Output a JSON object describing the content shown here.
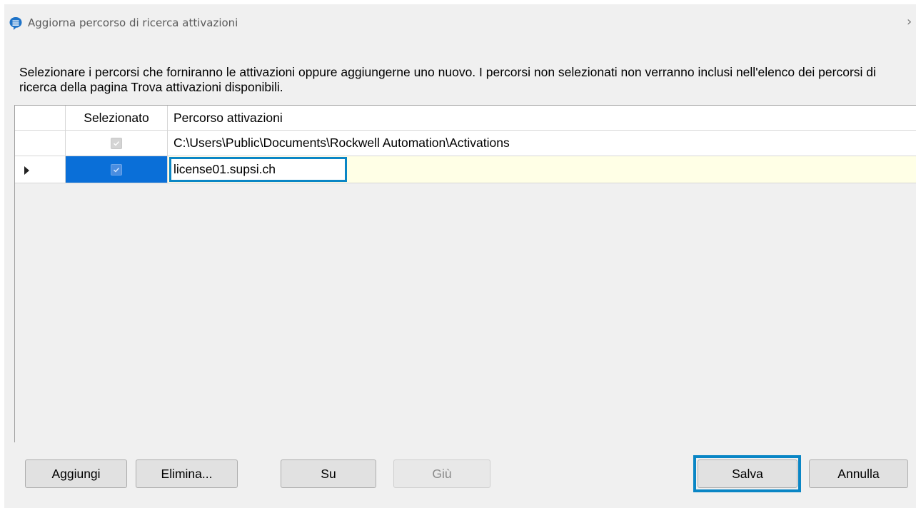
{
  "window": {
    "title": "Aggiorna percorso di ricerca attivazioni",
    "app_icon": "chat-bubble-icon",
    "close_icon": "close-icon"
  },
  "description": "Selezionare i percorsi che forniranno le attivazioni oppure aggiungerne uno nuovo. I percorsi non selezionati non verranno inclusi nell'elenco dei percorsi di ricerca della pagina Trova attivazioni disponibili.",
  "grid": {
    "columns": [
      "",
      "Selezionato",
      "Percorso attivazioni"
    ],
    "rows": [
      {
        "selected": true,
        "path": "C:\\Users\\Public\\Documents\\Rockwell Automation\\Activations",
        "editable": false
      },
      {
        "selected": true,
        "path": "license01.supsi.ch",
        "editing": true
      }
    ]
  },
  "buttons": {
    "add": "Aggiungi",
    "delete": "Elimina...",
    "up": "Su",
    "down": "Giù",
    "save": "Salva",
    "cancel": "Annulla"
  },
  "colors": {
    "highlight_border": "#0a86c5",
    "selection": "#0a6fd8",
    "edit_row": "#ffffe6"
  }
}
